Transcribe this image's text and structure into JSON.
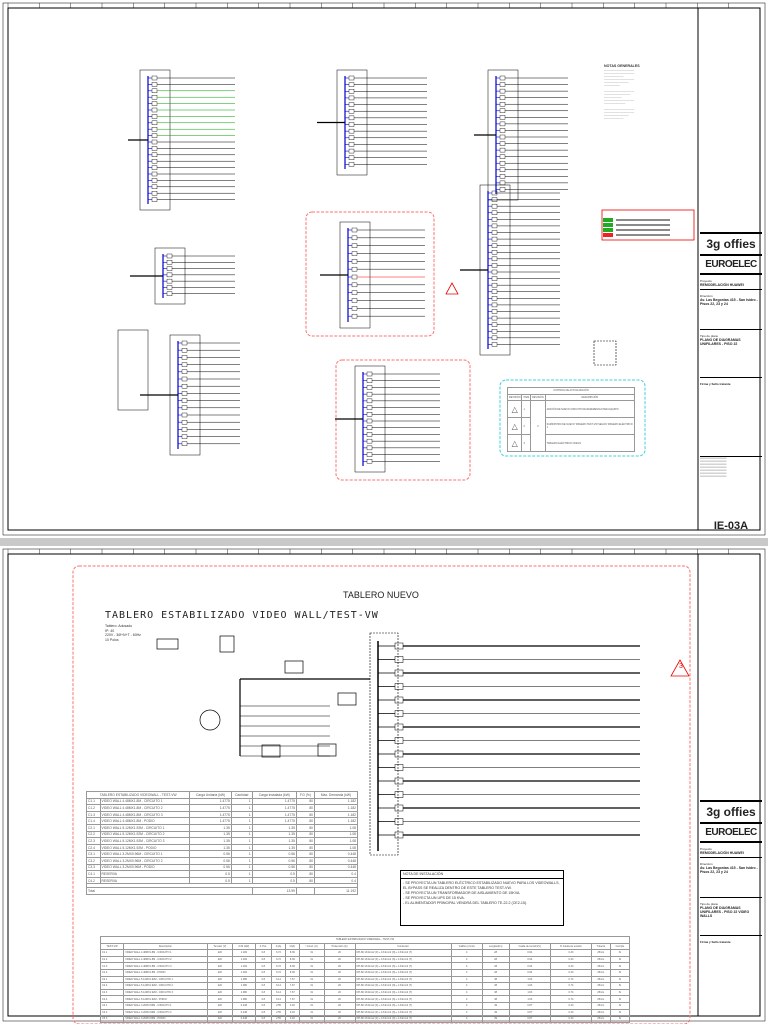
{
  "sheet1": {
    "project_label": "Proyecto",
    "project": "REMODELACIÓN HUAWEI",
    "address_label": "Dirección",
    "address": "Av. Las Begonias 415 - San Isidro - Pisos 22, 23 y 24",
    "plan_label": "Tipo de plano",
    "plan": "PLANO DE DIAGRAMAS UNIFILARES - PISO 22",
    "stamp_label": "Firma y Sello tratante",
    "logo_primary": "3g offies",
    "logo_secondary": "EUROELEC",
    "sheet_code": "IE-03A",
    "revisions": {
      "title": "CONTROL DE ACTUALIZACIÓN",
      "headers": [
        "REVISIÓN",
        "ITEM",
        "REVISIÓN",
        "DESCRIPCIÓN"
      ],
      "rows": [
        {
          "item": "1",
          "desc": "ADICIÓN DE NUEVO CIRCUITO DE REFERENCIA PARA EQUIPO"
        },
        {
          "item": "2",
          "desc": "SUMINISTRO DE NUEVO TABLERO TEST-VW SEGÚN TABLERO ELÉCTRICO 1"
        },
        {
          "item": "3",
          "desc": "TABLERO ELÉCTRICO NUEVO"
        }
      ],
      "rev": "0"
    },
    "notes_title": "NOTAS GENERALES"
  },
  "sheet2": {
    "section_title": "TABLERO NUEVO",
    "board_title": "TABLERO ESTABILIZADO VIDEO WALL/TEST-VW",
    "board_specs": [
      "Tablero: Adosado",
      "IP: 40",
      "220V - 3Ø+N+T - 60Hz",
      "10 Polos"
    ],
    "revision_marker": "3",
    "load_table": {
      "headers": [
        "TABLERO ESTABILIZADO VIDEOWALL - TEST-VW",
        "Carga Unitaria (kW)",
        "Cantidad",
        "Carga Instalada (kW)",
        "F.D (%)",
        "Máx. Demanda (kW)"
      ],
      "rows": [
        [
          "C1.1",
          "VIDEO WALL 4.48MX1.8M - CIRCUITO 1",
          "1.4775",
          "1",
          "1.4775",
          "80",
          "1.182"
        ],
        [
          "C1.2",
          "VIDEO WALL 4.48MX1.8M - CIRCUITO 2",
          "1.4775",
          "1",
          "1.4775",
          "80",
          "1.182"
        ],
        [
          "C1.3",
          "VIDEO WALL 4.48MX1.8M - CIRCUITO 3",
          "1.4775",
          "1",
          "1.4775",
          "80",
          "1.182"
        ],
        [
          "C1.4",
          "VIDEO WALL 4.48MX1.8M - PODIO",
          "1.4775",
          "1",
          "1.4775",
          "80",
          "1.182"
        ],
        [
          "C2.1",
          "VIDEO WALL 5.12MX1.92M - CIRCUITO 1",
          "1.35",
          "1",
          "1.35",
          "80",
          "1.08"
        ],
        [
          "C2.2",
          "VIDEO WALL 5.12MX1.92M - CIRCUITO 2",
          "1.35",
          "1",
          "1.35",
          "80",
          "1.08"
        ],
        [
          "C2.3",
          "VIDEO WALL 5.12MX1.92M - CIRCUITO 3",
          "1.35",
          "1",
          "1.35",
          "80",
          "1.08"
        ],
        [
          "C2.4",
          "VIDEO WALL 5.12MX1.92M - PODIO",
          "1.35",
          "1",
          "1.35",
          "80",
          "1.08"
        ],
        [
          "C3.1",
          "VIDEO WALL 3.2MX0.96M - CIRCUITO 1",
          "0.56",
          "1",
          "0.56",
          "80",
          "0.448"
        ],
        [
          "C3.2",
          "VIDEO WALL 3.2MX0.96M - CIRCUITO 2",
          "0.56",
          "1",
          "0.56",
          "80",
          "0.448"
        ],
        [
          "C3.3",
          "VIDEO WALL 3.2MX0.96M - PODIO",
          "0.56",
          "1",
          "0.56",
          "80",
          "0.448"
        ],
        [
          "C4.1",
          "RESERVA",
          "0.5",
          "1",
          "0.5",
          "80",
          "0.4"
        ],
        [
          "C4.2",
          "RESERVA",
          "0.5",
          "1",
          "0.5",
          "80",
          "0.4"
        ]
      ],
      "total_label": "Total",
      "total_installed": "13.99",
      "total_demand": "11.192"
    },
    "install_note": {
      "title": "NOTA DE INSTALACIÓN",
      "lines": [
        "- SE PROYECTA UN TABLERO ELÉCTRICO ESTABILIZADO NUEVO PARA LOS VIDEOWALLS, EL BYPASS SE REALIZA DENTRO DE ESTE TABLERO TEST-VW.",
        "- SE PROYECTA UN TRANSFORMADOR DE AISLAMIENTO DE 15KVA.",
        "- SE PROYECTA UN UPS DE 15 KVA.",
        "- EL ALIMENTADOR PRINCIPAL VENDRÁ DEL TABLERO TE-22.2 (CE2-15)."
      ]
    },
    "calc_table": {
      "title": "TABLERO ESTABILIZADO VIDEOWALL - TEST-VW",
      "headers": [
        "TEST-VW",
        "Descripción",
        "Tensión (V)",
        "D.M (kW)",
        "F. Pot.",
        "In(A)",
        "Id(A)",
        "I Cond. (A)",
        "Protección (A)",
        "Conductor",
        "Calibre (mm2)",
        "Longitud(m)",
        "Caída de tensión(V)",
        "% Caída de tensión",
        "Tubería",
        "Cumple"
      ],
      "rows": [
        [
          "C1.1",
          "VIDEO WALL 4.48MX1.8M - CIRCUITO 1",
          "220",
          "1.182",
          "0.8",
          "6.72",
          "8.39",
          "31",
          "20",
          "NH-80 1X4mm2 (F) + 1X4mm2 (N) + 1X4mm2 (T)",
          "4",
          "28",
          "0.94",
          "0.43",
          "25mm",
          "Si"
        ],
        [
          "C1.2",
          "VIDEO WALL 4.48MX1.8M - CIRCUITO 2",
          "220",
          "1.182",
          "0.8",
          "6.72",
          "8.39",
          "31",
          "20",
          "NH-80 1X4mm2 (F) + 1X4mm2 (N) + 1X4mm2 (T)",
          "4",
          "28",
          "0.94",
          "0.43",
          "25mm",
          "Si"
        ],
        [
          "C1.3",
          "VIDEO WALL 4.48MX1.8M - CIRCUITO 3",
          "220",
          "1.182",
          "0.8",
          "6.72",
          "8.39",
          "31",
          "20",
          "NH-80 1X4mm2 (F) + 1X4mm2 (N) + 1X4mm2 (T)",
          "4",
          "28",
          "0.94",
          "0.43",
          "25mm",
          "Si"
        ],
        [
          "C1.4",
          "VIDEO WALL 4.48MX1.8M - PODIO",
          "220",
          "1.182",
          "0.8",
          "6.72",
          "8.39",
          "31",
          "20",
          "NH-80 1X4mm2 (F) + 1X4mm2 (N) + 1X4mm2 (T)",
          "4",
          "28",
          "0.94",
          "0.43",
          "25mm",
          "Si"
        ],
        [
          "C2.1",
          "VIDEO WALL 5.12MX1.92M - CIRCUITO 1",
          "220",
          "1.080",
          "0.8",
          "6.14",
          "7.67",
          "31",
          "20",
          "NH-80 1X4mm2 (F) + 1X4mm2 (N) + 1X4mm2 (T)",
          "4",
          "38",
          "1.63",
          "0.74",
          "25mm",
          "Si"
        ],
        [
          "C2.2",
          "VIDEO WALL 5.12MX1.92M - CIRCUITO 2",
          "220",
          "1.080",
          "0.8",
          "6.14",
          "7.67",
          "31",
          "20",
          "NH-80 1X4mm2 (F) + 1X4mm2 (N) + 1X4mm2 (T)",
          "4",
          "38",
          "1.63",
          "0.74",
          "25mm",
          "Si"
        ],
        [
          "C2.3",
          "VIDEO WALL 5.12MX1.92M - CIRCUITO 3",
          "220",
          "1.080",
          "0.8",
          "6.14",
          "7.67",
          "31",
          "20",
          "NH-80 1X4mm2 (F) + 1X4mm2 (N) + 1X4mm2 (T)",
          "4",
          "38",
          "1.63",
          "0.74",
          "25mm",
          "Si"
        ],
        [
          "C2.4",
          "VIDEO WALL 5.12MX1.92M - PODIO",
          "220",
          "1.080",
          "0.8",
          "6.14",
          "7.67",
          "31",
          "20",
          "NH-80 1X4mm2 (F) + 1X4mm2 (N) + 1X4mm2 (T)",
          "4",
          "38",
          "1.63",
          "0.74",
          "25mm",
          "Si"
        ],
        [
          "C3.1",
          "VIDEO WALL 3.2MX0.96M - CIRCUITO 1",
          "220",
          "0.448",
          "0.8",
          "2.55",
          "3.18",
          "31",
          "20",
          "NH-80 1X4mm2 (F) + 1X4mm2 (N) + 1X4mm2 (T)",
          "4",
          "49",
          "0.87",
          "0.40",
          "25mm",
          "Si"
        ],
        [
          "C3.2",
          "VIDEO WALL 3.2MX0.96M - CIRCUITO 2",
          "220",
          "0.448",
          "0.8",
          "2.55",
          "3.18",
          "31",
          "20",
          "NH-80 1X4mm2 (F) + 1X4mm2 (N) + 1X4mm2 (T)",
          "4",
          "49",
          "0.87",
          "0.40",
          "25mm",
          "Si"
        ],
        [
          "C3.3",
          "VIDEO WALL 3.2MX0.96M - PODIO",
          "220",
          "0.448",
          "0.8",
          "2.55",
          "3.18",
          "31",
          "20",
          "NH-80 1X4mm2 (F) + 1X4mm2 (N) + 1X4mm2 (T)",
          "4",
          "49",
          "0.87",
          "0.40",
          "25mm",
          "Si"
        ]
      ]
    },
    "project_label": "Proyecto",
    "project": "REMODELACIÓN HUAWEI",
    "address_label": "Dirección",
    "address": "Av. Las Begonias 415 - San Isidro - Pisos 22, 23 y 24",
    "plan_label": "Tipo de plano",
    "plan": "PLANO DE DIAGRAMAS UNIFILARES - PISO 22 VIDEO WALLS",
    "stamp_label": "Firma y Sello tratante",
    "logo_primary": "3g offies",
    "logo_secondary": "EUROELEC"
  },
  "colors": {
    "bus": "#0000cc",
    "highlight": "#ff0000",
    "cloud": "#ff7070",
    "cloud_cyan": "#40d0e0",
    "green": "#00a000"
  }
}
